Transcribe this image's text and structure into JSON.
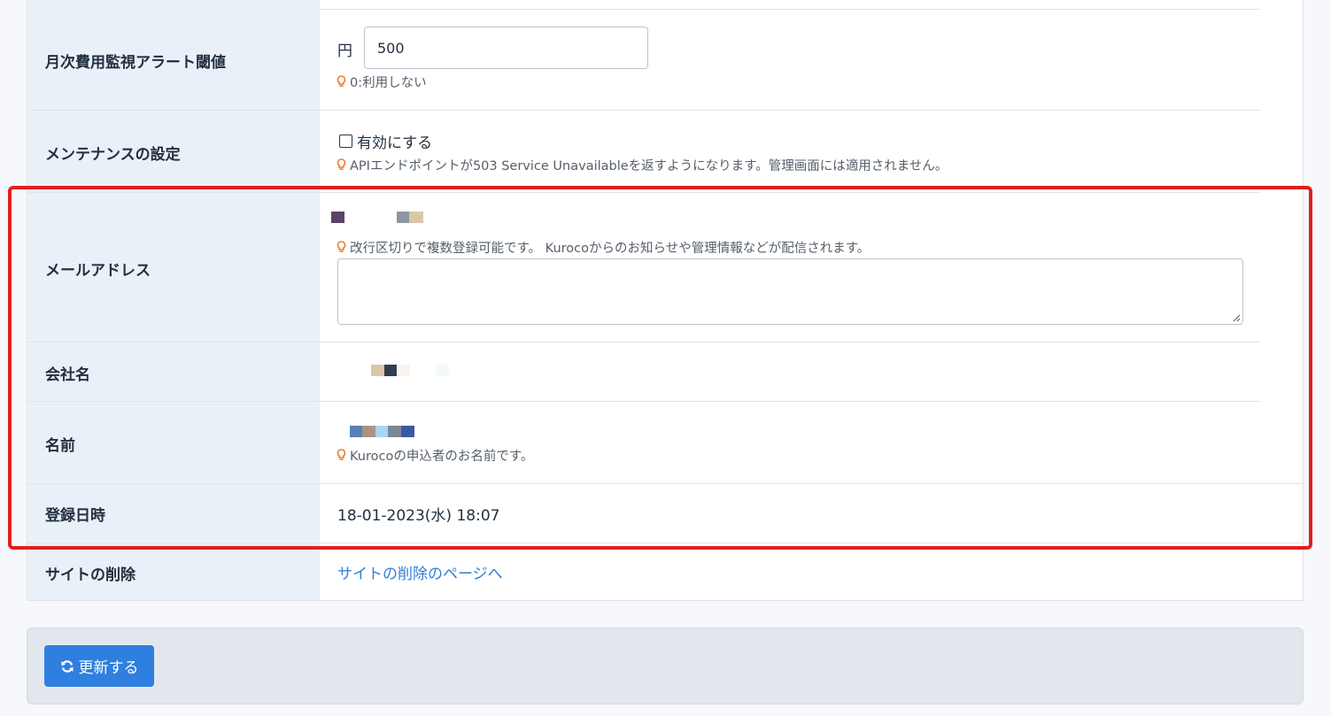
{
  "fields": {
    "monthly_alert": {
      "label": "月次費用監視アラート閾値",
      "unit": "円",
      "value": "500",
      "help": "0:利用しない"
    },
    "maintenance": {
      "label": "メンテナンスの設定",
      "checkbox_label": "有効にする",
      "checked": false,
      "help": "APIエンドポイントが503 Service Unavailableを返すようになります。管理画面には適用されません。"
    },
    "email": {
      "label": "メールアドレス",
      "help": "改行区切りで複数登録可能です。 Kurocoからのお知らせや管理情報などが配信されます。",
      "value": ""
    },
    "company": {
      "label": "会社名"
    },
    "name": {
      "label": "名前",
      "help": "Kurocoの申込者のお名前です。"
    },
    "registered_at": {
      "label": "登録日時",
      "value": "18-01-2023(水) 18:07"
    },
    "delete_site": {
      "label": "サイトの削除",
      "link_text": "サイトの削除のページへ"
    }
  },
  "actions": {
    "update_label": "更新する"
  },
  "colors": {
    "accent": "#2f7fe0",
    "highlight": "#e01e1e",
    "hint_icon": "#f07c2d",
    "label_bg": "#eaf0f8"
  }
}
